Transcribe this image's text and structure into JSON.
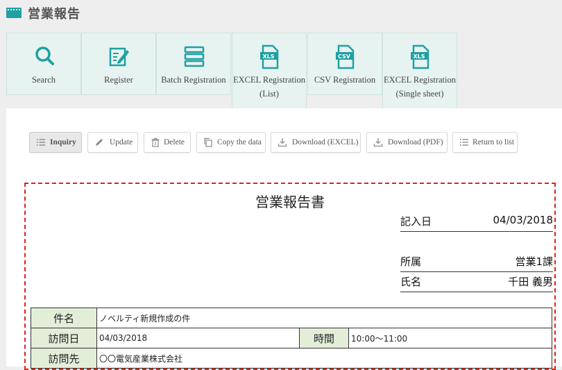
{
  "page": {
    "title": "営業報告"
  },
  "tiles": [
    {
      "label": "Search",
      "icon": "search-icon"
    },
    {
      "label": "Register",
      "icon": "edit-icon"
    },
    {
      "label": "Batch Registration",
      "icon": "batch-list-icon"
    },
    {
      "label_line1": "EXCEL Registration",
      "label_line2": "(List)",
      "icon": "xls-file-icon",
      "badge": "XLS"
    },
    {
      "label": "CSV Registration",
      "icon": "csv-file-icon",
      "badge": "CSV"
    },
    {
      "label_line1": "EXCEL Registration",
      "label_line2": "(Single sheet)",
      "icon": "xls-file-icon",
      "badge": "XLS"
    }
  ],
  "toolbar": {
    "inquiry": "Inquiry",
    "update": "Update",
    "delete": "Delete",
    "copy": "Copy the data",
    "download_excel": "Download (EXCEL)",
    "download_pdf": "Download (PDF)",
    "return": "Return to list"
  },
  "report": {
    "title": "営業報告書",
    "entry_date_label": "記入日",
    "entry_date": "04/03/2018",
    "dept_label": "所属",
    "dept": "営業1課",
    "name_label": "氏名",
    "name": "千田 義男",
    "subject_label": "件名",
    "subject": "ノベルティ新規作成の件",
    "visit_date_label": "訪問日",
    "visit_date": "04/03/2018",
    "time_label": "時間",
    "time": "10:00～11:00",
    "visit_to_label": "訪問先",
    "visit_to": "〇〇電気産業株式会社"
  },
  "colors": {
    "accent": "#1fa0a3",
    "tile_bg": "#e6f3f1",
    "header_cell": "#e3eed9",
    "highlight_border": "#e02020"
  }
}
